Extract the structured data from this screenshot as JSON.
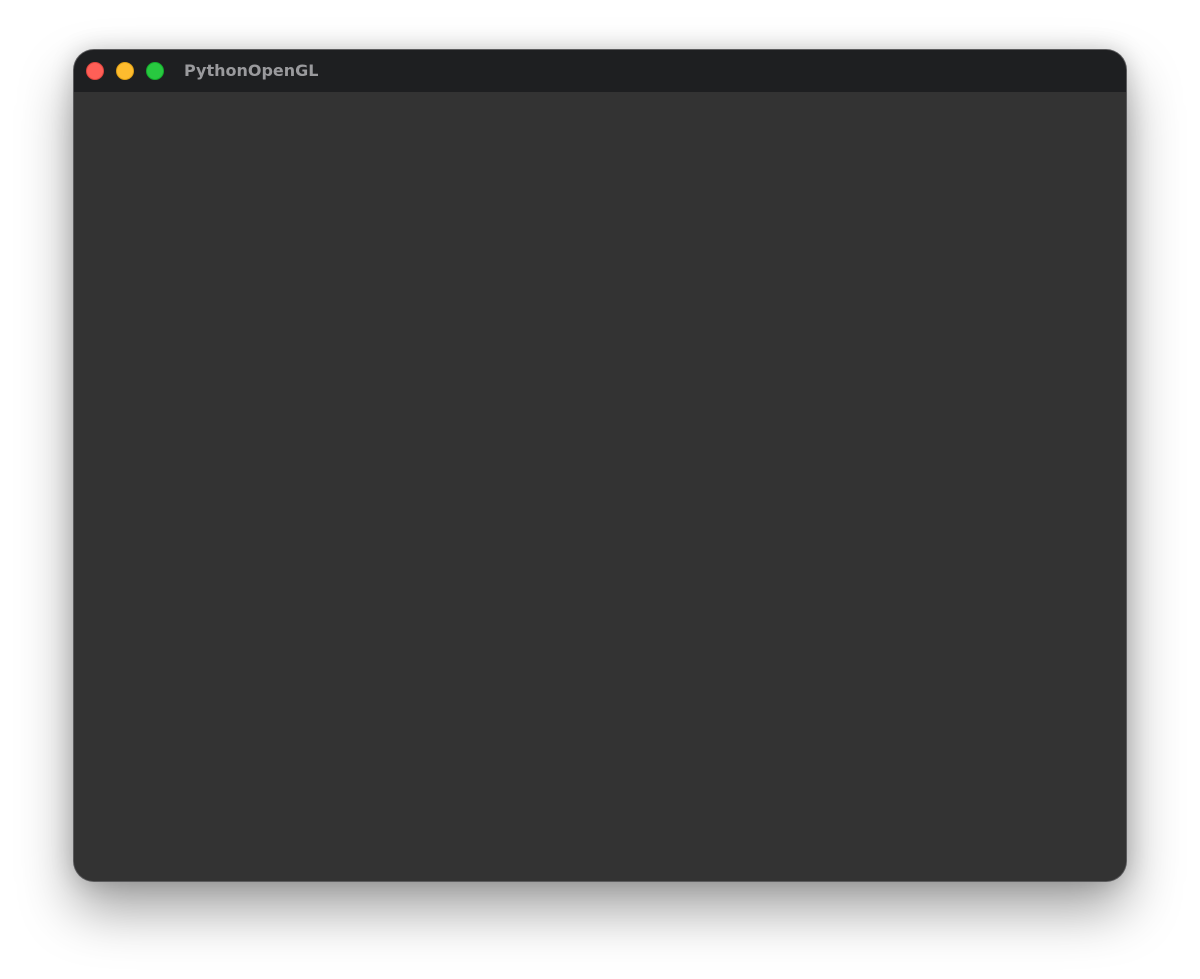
{
  "window": {
    "title": "PythonOpenGL",
    "traffic_lights": [
      {
        "name": "close",
        "color": "#ff5f57"
      },
      {
        "name": "minimize",
        "color": "#febc2e"
      },
      {
        "name": "zoom",
        "color": "#28c840"
      }
    ],
    "titlebar_color": "#1e1f21",
    "content_color": "#333333"
  }
}
